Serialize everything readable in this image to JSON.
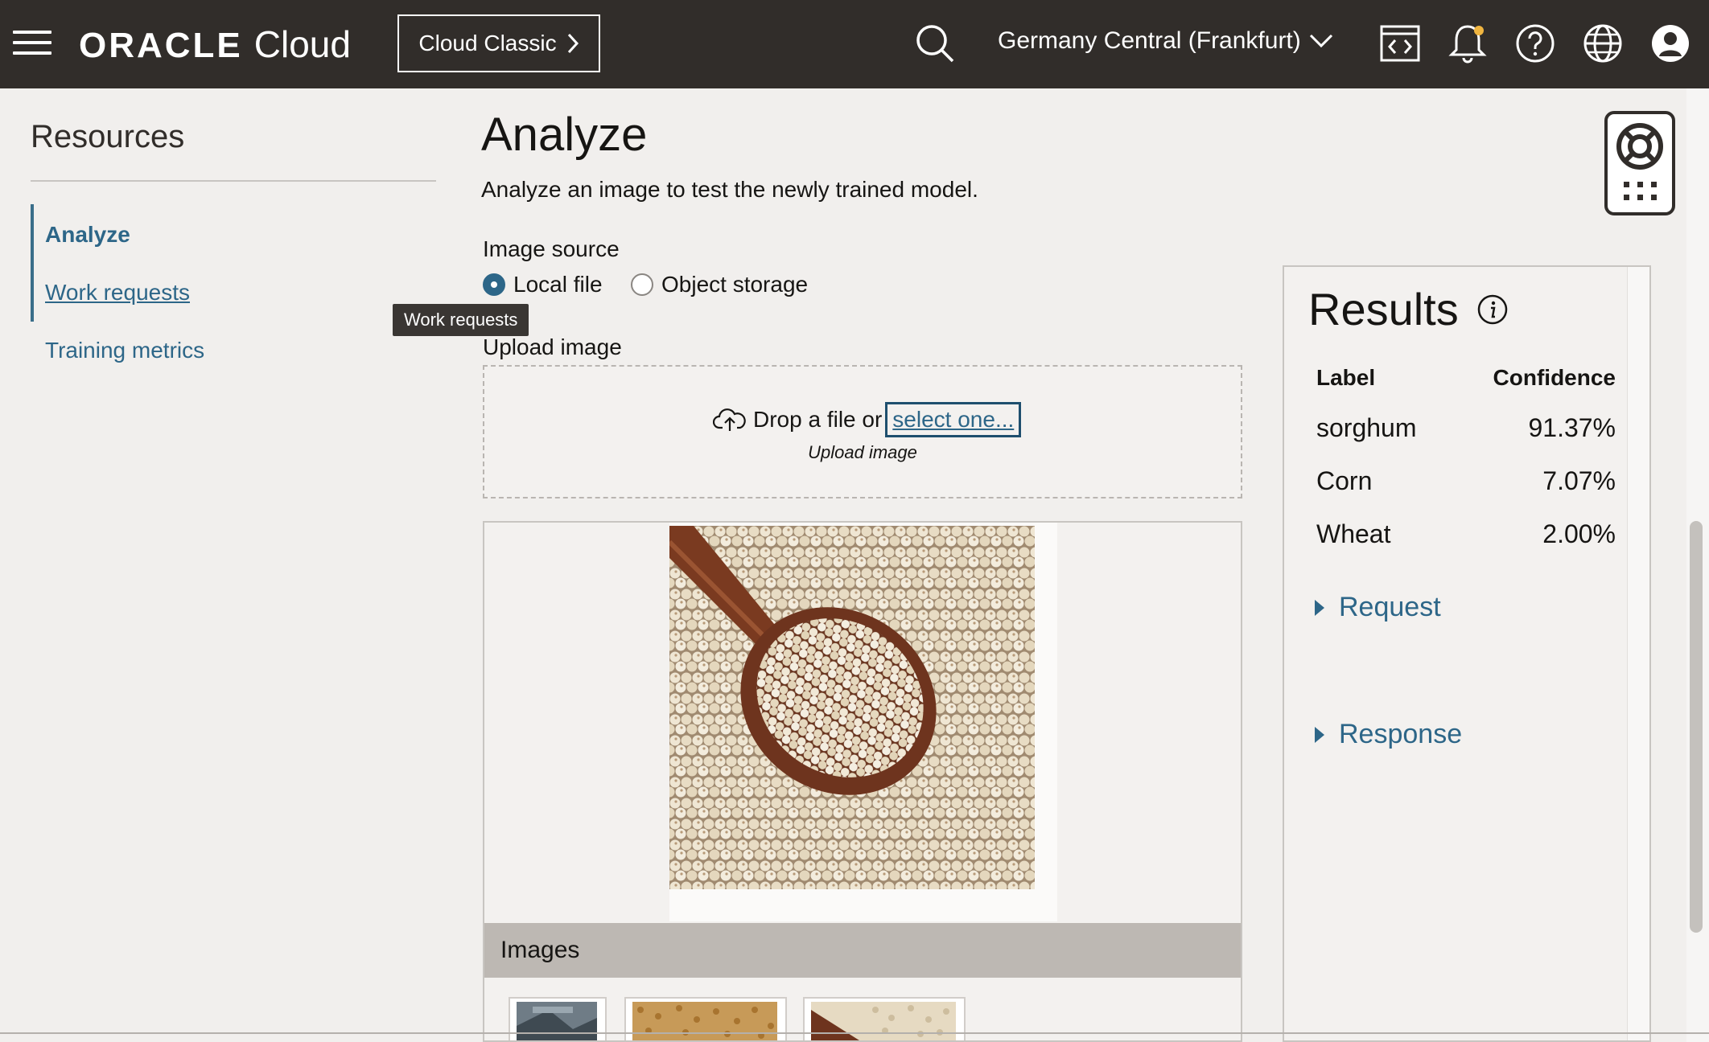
{
  "header": {
    "brand": "ORACLE",
    "brand_product": "Cloud",
    "classic_button": "Cloud Classic",
    "region": "Germany Central (Frankfurt)",
    "icons": [
      "menu-icon",
      "search-icon",
      "chevron-down-icon",
      "code-editor-icon",
      "bell-icon",
      "help-icon",
      "globe-icon",
      "user-avatar-icon"
    ]
  },
  "sidebar": {
    "title": "Resources",
    "items": [
      {
        "label": "Analyze",
        "active": true
      },
      {
        "label": "Work requests",
        "active": false
      },
      {
        "label": "Training metrics",
        "active": false
      }
    ],
    "tooltip": "Work requests"
  },
  "main": {
    "title": "Analyze",
    "description": "Analyze an image to test the newly trained model.",
    "image_source_label": "Image source",
    "radio_options": [
      {
        "label": "Local file",
        "selected": true
      },
      {
        "label": "Object storage",
        "selected": false
      }
    ],
    "upload_label": "Upload image",
    "drop_text": "Drop a file or",
    "select_link": "select one...",
    "drop_sub": "Upload image",
    "images_header": "Images"
  },
  "results": {
    "title": "Results",
    "col_label": "Label",
    "col_confidence": "Confidence",
    "rows": [
      {
        "label": "sorghum",
        "confidence": "91.37%"
      },
      {
        "label": "Corn",
        "confidence": "7.07%"
      },
      {
        "label": "Wheat",
        "confidence": "2.00%"
      }
    ],
    "request_label": "Request",
    "response_label": "Response"
  },
  "colors": {
    "header_bg": "#312d2a",
    "link": "#2d6688",
    "page_bg": "#f1efed"
  }
}
